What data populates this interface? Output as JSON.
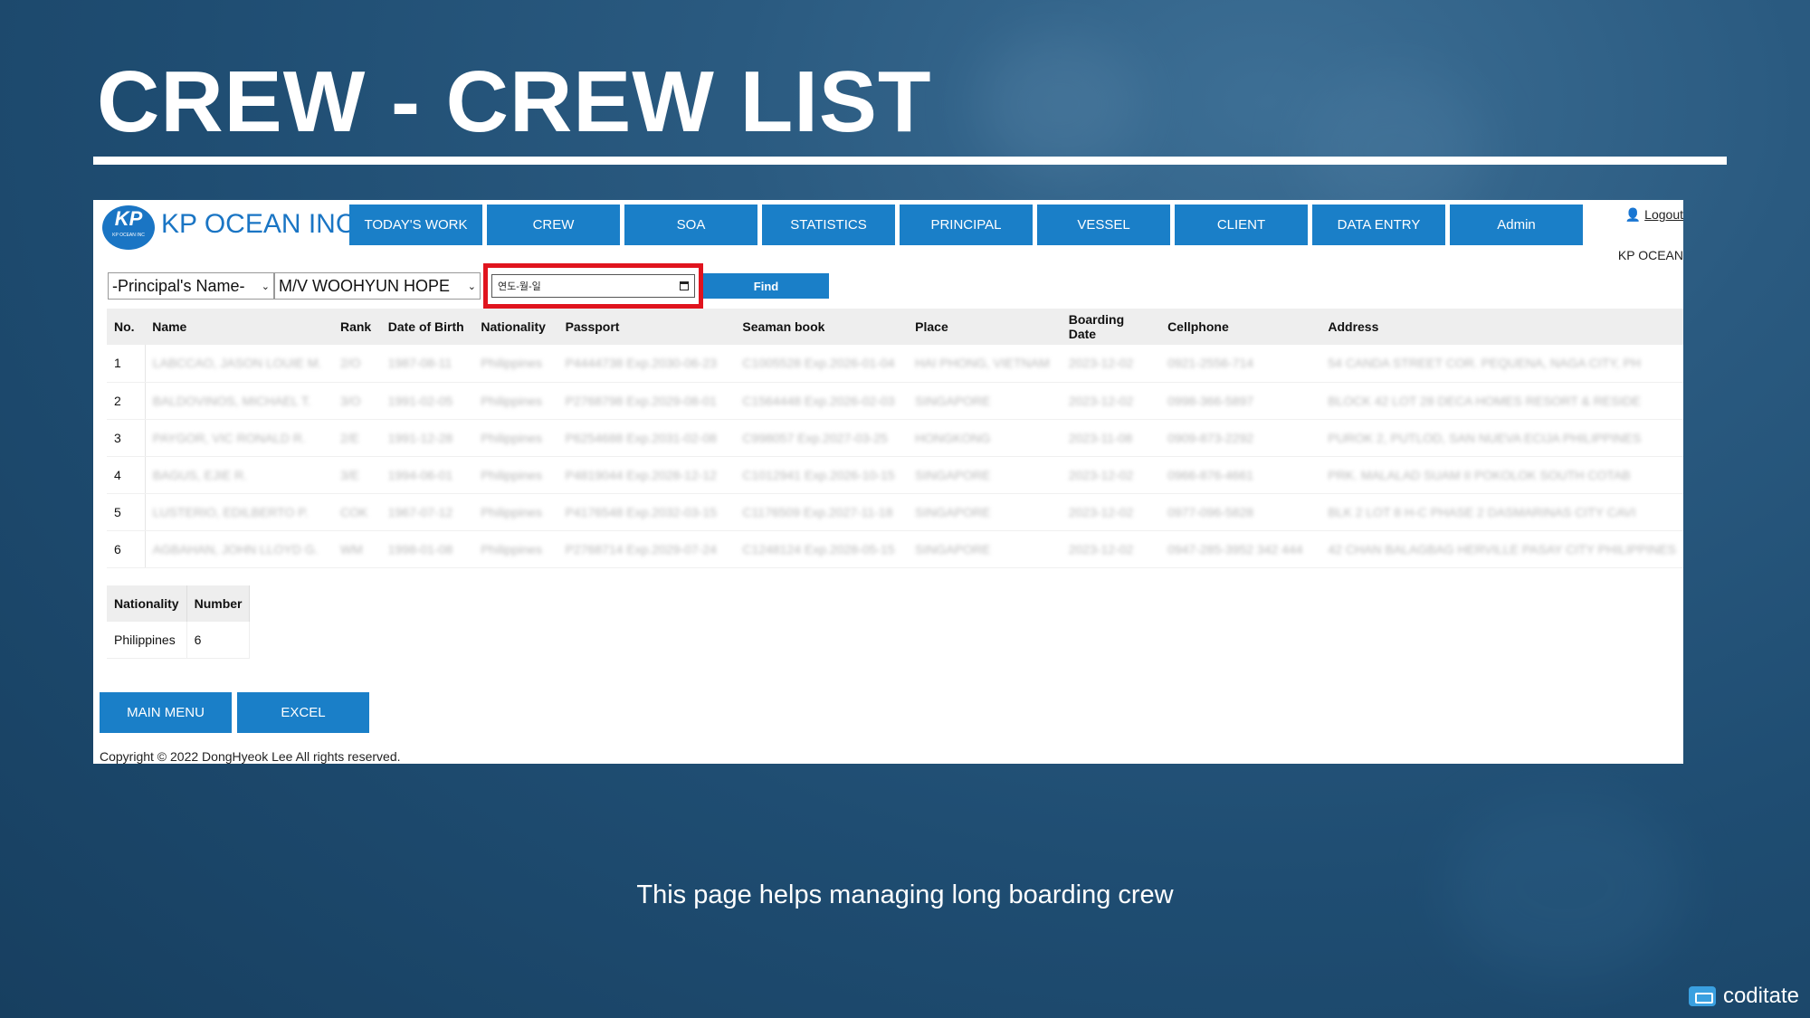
{
  "slide": {
    "title": "CREW - CREW LIST",
    "caption": "This page helps managing long boarding crew",
    "watermark": "coditate"
  },
  "app": {
    "logo_mark": "KP",
    "logo_sub": "KP OCEAN INC",
    "brand": "KP OCEAN INC",
    "nav": [
      "TODAY'S WORK",
      "CREW",
      "SOA",
      "STATISTICS",
      "PRINCIPAL",
      "VESSEL",
      "CLIENT",
      "DATA ENTRY",
      "Admin"
    ],
    "user": {
      "logout_label": "Logout",
      "company": "KP OCEAN",
      "icon": "user-icon"
    },
    "filters": {
      "principal": "-Principal's Name-",
      "vessel": "M/V WOOHYUN HOPE",
      "date_placeholder": "연도-월-일",
      "find_label": "Find"
    },
    "crew_table": {
      "headers": [
        "No.",
        "Name",
        "Rank",
        "Date of Birth",
        "Nationality",
        "Passport",
        "Seaman book",
        "Place",
        "Boarding Date",
        "Cellphone",
        "Address"
      ],
      "rows": [
        [
          "1",
          "LABCCAO, JASON LOUIE M.",
          "2/O",
          "1987-08-11",
          "Philippines",
          "P4444738 Exp.2030-06-23",
          "C1005528 Exp.2026-01-04",
          "HAI PHONG, VIETNAM",
          "2023-12-02",
          "0921-2556-714",
          "54 CANDA STREET COR. PEQUENA, NAGA CITY, PH"
        ],
        [
          "2",
          "BALDOVINOS, MICHAEL T.",
          "3/O",
          "1991-02-05",
          "Philippines",
          "P2768798 Exp.2029-08-01",
          "C1564448 Exp.2026-02-03",
          "SINGAPORE",
          "2023-12-02",
          "0998-366-5897",
          "BLOCK 42 LOT 28 DECA HOMES RESORT & RESIDE"
        ],
        [
          "3",
          "PAYGOR, VIC RONALD R.",
          "2/E",
          "1991-12-28",
          "Philippines",
          "P6254688 Exp.2031-02-08",
          "C998057 Exp.2027-03-25",
          "HONGKONG",
          "2023-11-08",
          "0909-873-2292",
          "PUROK 2, PUTLOD, SAN NUEVA ECIJA PHILIPPINES"
        ],
        [
          "4",
          "BAGUS, EJIE R.",
          "3/E",
          "1994-06-01",
          "Philippines",
          "P4819044 Exp.2028-12-12",
          "C1012941 Exp.2026-10-15",
          "SINGAPORE",
          "2023-12-02",
          "0966-876-4661",
          "PRK. MALALAD SUAM II POKOLOK SOUTH COTAB"
        ],
        [
          "5",
          "LUSTERIO, EDILBERTO P.",
          "COK",
          "1967-07-12",
          "Philippines",
          "P4176548 Exp.2032-03-15",
          "C1176509 Exp.2027-11-18",
          "SINGAPORE",
          "2023-12-02",
          "0977-096-5828",
          "BLK 2 LOT 8 H-C PHASE 2 DASMARINAS CITY CAVI"
        ],
        [
          "6",
          "AGBAHAN, JOHN LLOYD G.",
          "WM",
          "1998-01-08",
          "Philippines",
          "P2768714 Exp.2029-07-24",
          "C1248124 Exp.2028-05-15",
          "SINGAPORE",
          "2023-12-02",
          "0947-285-3952 342 444",
          "42 CHAN BALAGBAG HERVILLE PASAY CITY PHILIPPINES"
        ]
      ]
    },
    "nationality_table": {
      "headers": [
        "Nationality",
        "Number"
      ],
      "rows": [
        [
          "Philippines",
          "6"
        ]
      ]
    },
    "buttons": {
      "main_menu": "MAIN MENU",
      "excel": "EXCEL"
    },
    "copyright": "Copyright © 2022 DongHyeok Lee All rights reserved."
  },
  "colors": {
    "accent": "#1a7fc8",
    "highlight": "#e0141e",
    "background": "#1f4d72"
  }
}
